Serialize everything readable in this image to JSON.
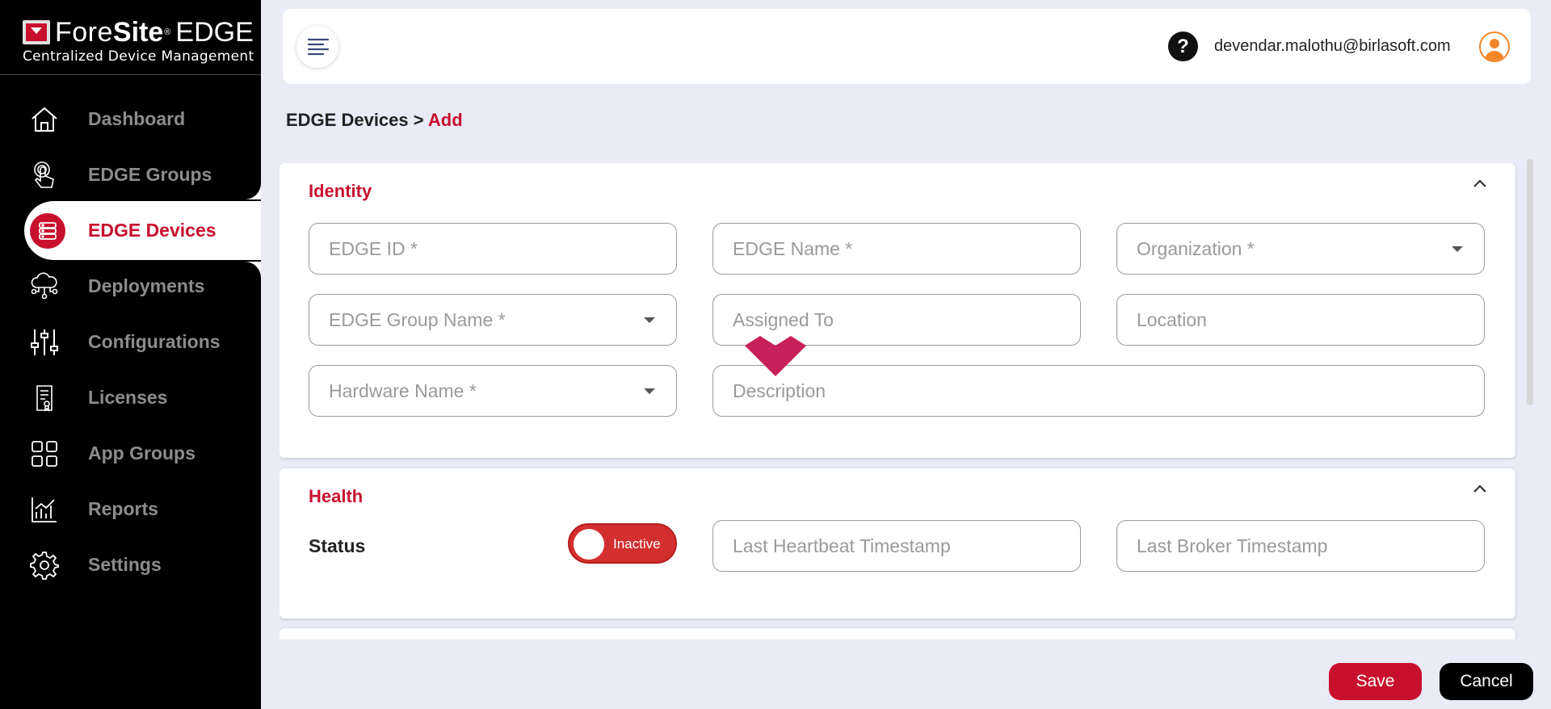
{
  "app": {
    "brand_fore": "Fore",
    "brand_site": "Site",
    "brand_reg": "®",
    "brand_edge": "EDGE",
    "brand_subtitle": "Centralized Device Management"
  },
  "sidebar": {
    "items": [
      {
        "label": "Dashboard",
        "icon": "home-icon"
      },
      {
        "label": "EDGE Groups",
        "icon": "touch-icon"
      },
      {
        "label": "EDGE Devices",
        "icon": "server-icon",
        "active": true
      },
      {
        "label": "Deployments",
        "icon": "cloud-network-icon"
      },
      {
        "label": "Configurations",
        "icon": "sliders-icon"
      },
      {
        "label": "Licenses",
        "icon": "certificate-icon"
      },
      {
        "label": "App Groups",
        "icon": "grid-icon"
      },
      {
        "label": "Reports",
        "icon": "chart-icon"
      },
      {
        "label": "Settings",
        "icon": "gear-icon"
      }
    ]
  },
  "header": {
    "help": "?",
    "user_email": "devendar.malothu@birlasoft.com"
  },
  "breadcrumb": {
    "parent": "EDGE Devices",
    "separator": " > ",
    "current": "Add"
  },
  "identity": {
    "title": "Identity",
    "edge_id_placeholder": "EDGE ID *",
    "edge_name_placeholder": "EDGE Name *",
    "organization_placeholder": "Organization *",
    "group_name_placeholder": "EDGE Group Name *",
    "assigned_to_placeholder": "Assigned To",
    "location_placeholder": "Location",
    "hardware_name_placeholder": "Hardware Name *",
    "description_placeholder": "Description"
  },
  "health": {
    "title": "Health",
    "status_label": "Status",
    "status_toggle": "Inactive",
    "heartbeat_placeholder": "Last Heartbeat Timestamp",
    "broker_placeholder": "Last Broker Timestamp"
  },
  "footer": {
    "save_label": "Save",
    "cancel_label": "Cancel"
  },
  "colors": {
    "accent": "#c8102e",
    "sidebar_bg": "#000000",
    "page_bg": "#e9ebf6",
    "toggle_inactive": "#d32f2f"
  }
}
